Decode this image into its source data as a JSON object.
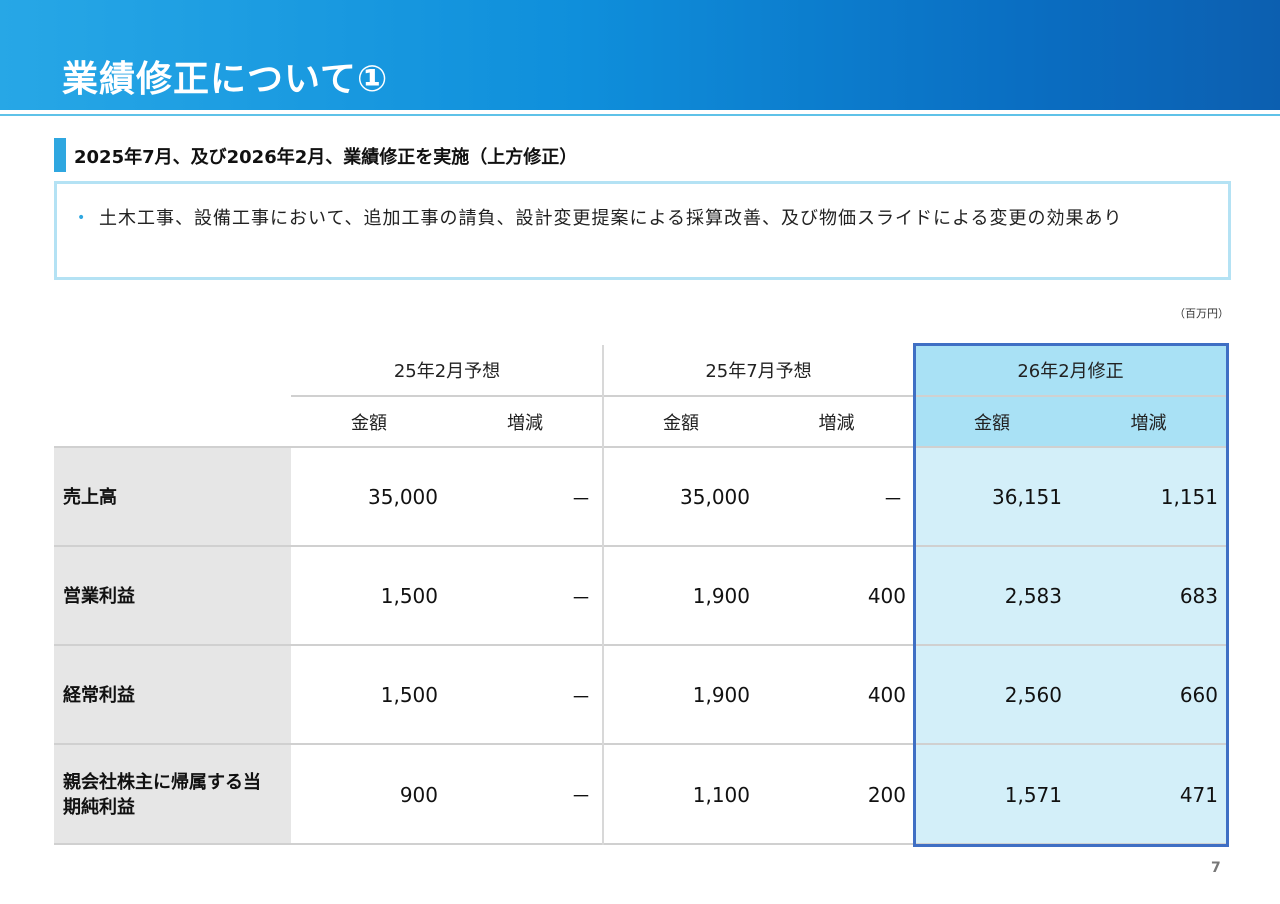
{
  "header": {
    "title": "業績修正について①"
  },
  "subheading": "2025年7月、及び2026年2月、業績修正を実施（上方修正）",
  "note": {
    "bullet": "•",
    "text": "土木工事、設備工事において、追加工事の請負、設計変更提案による採算改善、及び物価スライドによる変更の効果あり"
  },
  "unit": "（百万円）",
  "table": {
    "groups": [
      "25年2月予想",
      "25年7月予想",
      "26年2月修正"
    ],
    "subcols": [
      "金額",
      "増減",
      "金額",
      "増減",
      "金額",
      "増減"
    ],
    "rows": [
      {
        "label": "売上高",
        "values": [
          "35,000",
          "－",
          "35,000",
          "－",
          "36,151",
          "1,151"
        ]
      },
      {
        "label": "営業利益",
        "values": [
          "1,500",
          "－",
          "1,900",
          "400",
          "2,583",
          "683"
        ]
      },
      {
        "label": "経常利益",
        "values": [
          "1,500",
          "－",
          "1,900",
          "400",
          "2,560",
          "660"
        ]
      },
      {
        "label": "親会社株主に帰属する当期純利益",
        "values": [
          "900",
          "－",
          "1,100",
          "200",
          "1,571",
          "471"
        ]
      }
    ]
  },
  "page_number": "7"
}
